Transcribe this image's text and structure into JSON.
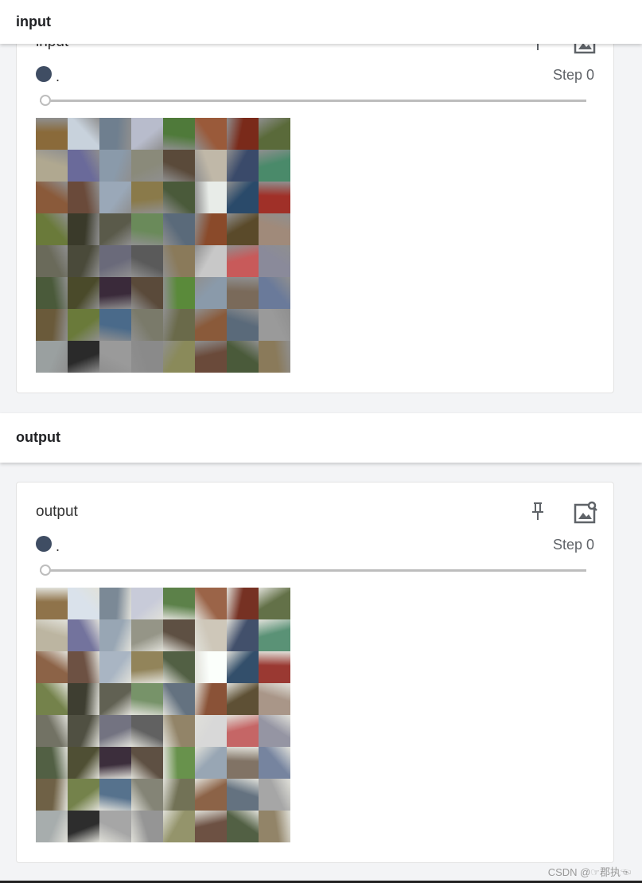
{
  "sections": [
    {
      "header": "input",
      "card": {
        "title": "input",
        "run": ".",
        "step": "Step 0",
        "step_index": 0
      }
    },
    {
      "header": "output",
      "card": {
        "title": "output",
        "run": ".",
        "step": "Step 0",
        "step_index": 0
      }
    }
  ],
  "colors": {
    "run_dot": "#3f4d63",
    "background": "#f3f4f6"
  },
  "icons": {
    "pin": "pin-icon",
    "image_search": "image-search-icon"
  },
  "watermark": "CSDN @☞郡执☜"
}
